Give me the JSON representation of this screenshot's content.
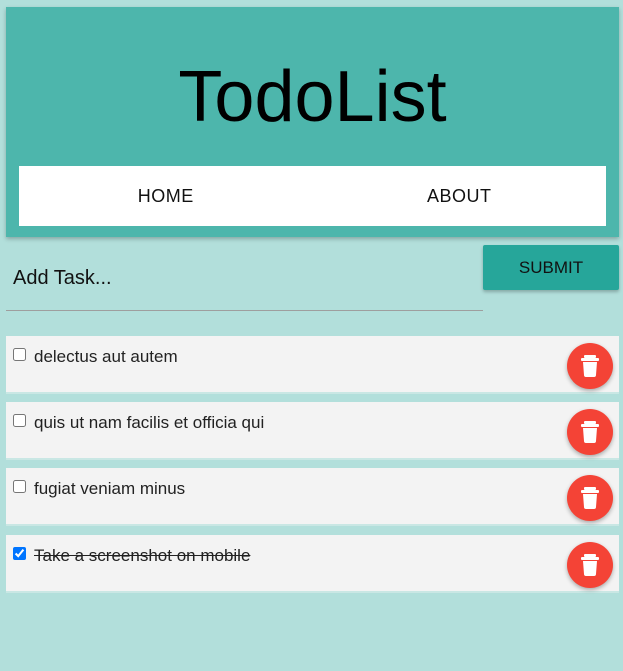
{
  "app": {
    "title": "TodoList"
  },
  "nav": {
    "items": [
      {
        "label": "HOME"
      },
      {
        "label": "ABOUT"
      }
    ]
  },
  "add_task": {
    "placeholder": "Add Task...",
    "value": "",
    "submit_label": "SUBMIT"
  },
  "tasks": [
    {
      "label": "delectus aut autem",
      "completed": false
    },
    {
      "label": "quis ut nam facilis et officia qui",
      "completed": false
    },
    {
      "label": "fugiat veniam minus",
      "completed": false
    },
    {
      "label": "Take a screenshot on mobile",
      "completed": true
    }
  ],
  "icons": {
    "delete": "trash-icon"
  },
  "colors": {
    "background": "#b2dfdb",
    "header": "#4db6ac",
    "submit": "#26a69a",
    "delete": "#f44336",
    "task_bg": "#f3f3f3"
  }
}
